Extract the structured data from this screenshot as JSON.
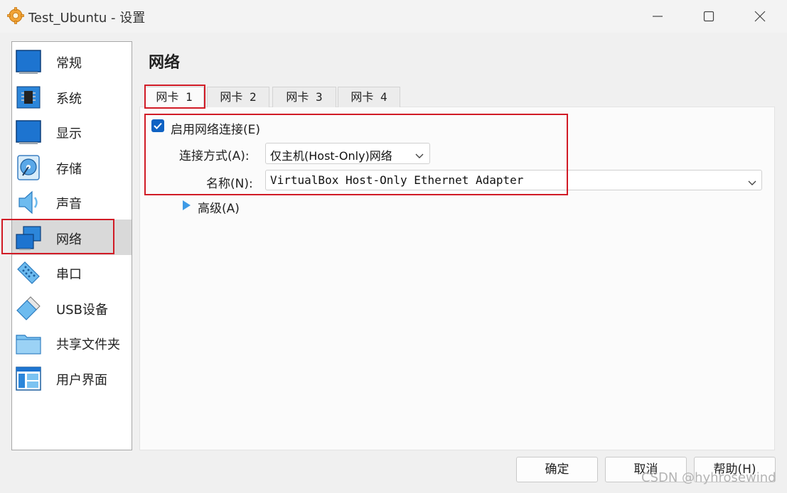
{
  "window": {
    "title": "Test_Ubuntu - 设置"
  },
  "sidebar": {
    "items": [
      {
        "label": "常规",
        "icon": "general-icon"
      },
      {
        "label": "系统",
        "icon": "system-chip-icon"
      },
      {
        "label": "显示",
        "icon": "display-icon"
      },
      {
        "label": "存储",
        "icon": "storage-disk-icon"
      },
      {
        "label": "声音",
        "icon": "speaker-icon"
      },
      {
        "label": "网络",
        "icon": "network-icon",
        "selected": true
      },
      {
        "label": "串口",
        "icon": "serial-port-icon"
      },
      {
        "label": "USB设备",
        "icon": "usb-icon"
      },
      {
        "label": "共享文件夹",
        "icon": "shared-folder-icon"
      },
      {
        "label": "用户界面",
        "icon": "user-interface-icon"
      }
    ]
  },
  "main": {
    "title": "网络",
    "tabs": [
      {
        "label": "网卡 1",
        "active": true
      },
      {
        "label": "网卡 2"
      },
      {
        "label": "网卡 3"
      },
      {
        "label": "网卡 4"
      }
    ],
    "enable_label": "启用网络连接(E)",
    "enable_checked": true,
    "attach_label": "连接方式(A):",
    "attach_value": "仅主机(Host-Only)网络",
    "name_label": "名称(N):",
    "name_value": "VirtualBox Host-Only Ethernet Adapter",
    "advanced_label": "高级(A)"
  },
  "buttons": {
    "ok": "确定",
    "cancel": "取消",
    "help": "帮助(H)"
  },
  "watermark": "CSDN @hyhrosewind",
  "colors": {
    "accent": "#0f62c3",
    "highlight": "#d11b26"
  }
}
